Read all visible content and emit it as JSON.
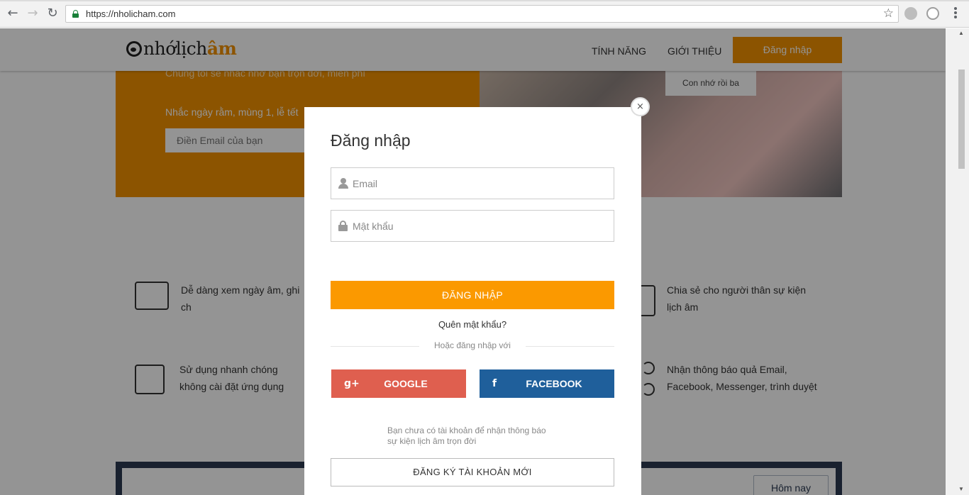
{
  "browser": {
    "url": "https://nholicham.com",
    "back_glyph": "←",
    "forward_glyph": "→",
    "reload_glyph": "↻",
    "star_glyph": "☆"
  },
  "header": {
    "logo_prefix": "nhớlịch",
    "logo_accent": "âm",
    "nav": [
      {
        "label": "TÍNH NĂNG"
      },
      {
        "label": "GIỚI THIỆU"
      }
    ],
    "login_label": "Đăng nhập"
  },
  "hero": {
    "tagline": "Chúng tôi sẽ nhắc nhở bạn trọn đời, miễn phí",
    "remind": "Nhắc ngày rằm, mùng 1, lễ tết",
    "email_placeholder": "Điền Email của bạn",
    "photo_label": "Con nhớ rồi ba"
  },
  "features": [
    {
      "text": "Dễ dàng xem ngày âm, ghi ch"
    },
    {
      "text": "Sử dụng nhanh chóng không cài đặt ứng dụng"
    },
    {
      "text": "Chia sẻ cho người thân sự kiện lịch âm"
    },
    {
      "text": "Nhận thông báo quả Email, Facebook, Messenger, trình duyệt"
    }
  ],
  "bottom": {
    "today_label": "Hôm nay"
  },
  "modal": {
    "close_glyph": "×",
    "title": "Đăng nhập",
    "email_placeholder": "Email",
    "password_placeholder": "Mật khẩu",
    "submit_label": "ĐĂNG NHẬP",
    "forgot_label": "Quên mật khẩu?",
    "or_label": "Hoặc đăng nhập với",
    "google_icon": "g+",
    "google_label": "GOOGLE",
    "facebook_icon": "f",
    "facebook_label": "FACEBOOK",
    "signup_note_1": "Bạn chưa có tài khoản để nhận thông báo",
    "signup_note_2": "sự kiện lịch âm trọn đời",
    "signup_label": "ĐĂNG KÝ TÀI KHOẢN MỚI"
  },
  "colors": {
    "brand_orange": "#f29200",
    "google": "#df5f4f",
    "facebook": "#1f5f9b",
    "navy": "#2b3a52"
  }
}
